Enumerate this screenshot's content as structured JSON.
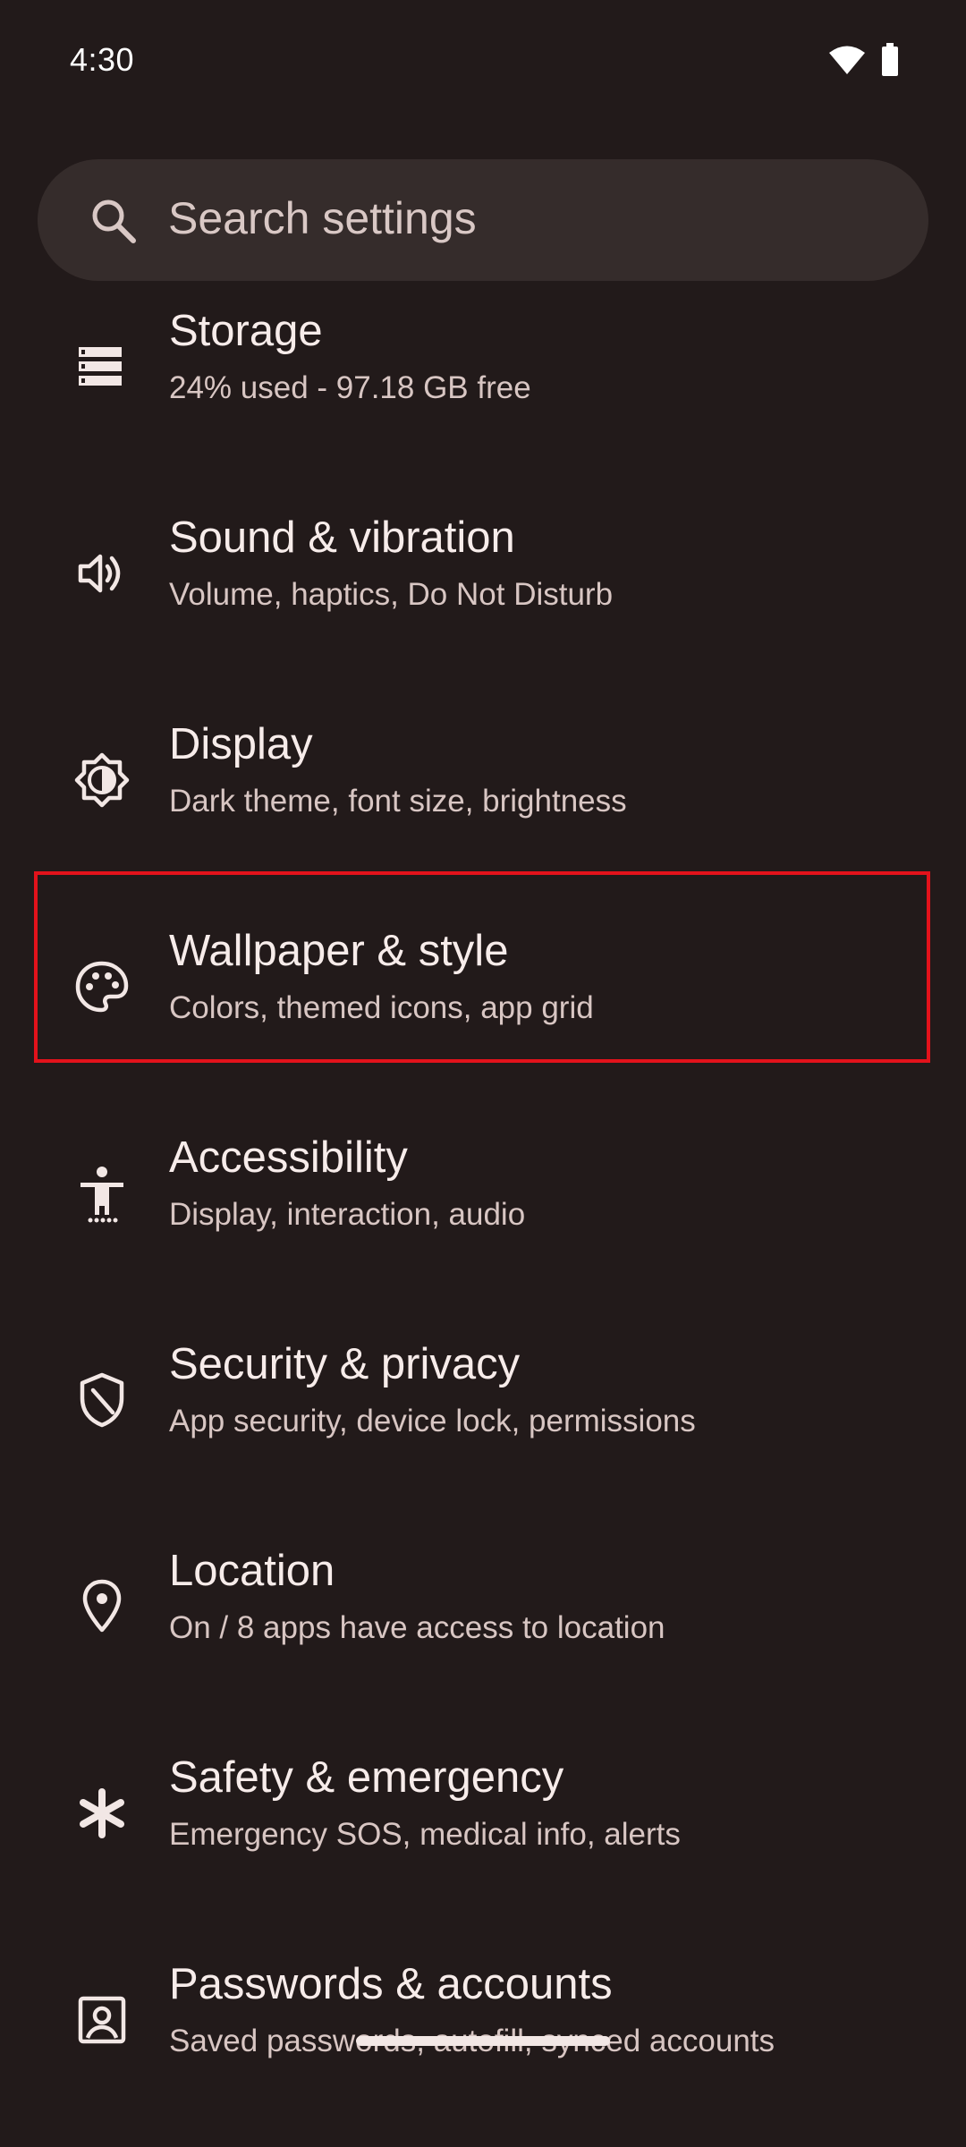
{
  "status_bar": {
    "time": "4:30",
    "wifi_icon": "wifi-icon",
    "battery_icon": "battery-icon"
  },
  "search": {
    "placeholder": "Search settings",
    "icon": "search-icon"
  },
  "settings": [
    {
      "title": "Storage",
      "summary": "24% used - 97.18 GB free",
      "icon": "storage-icon"
    },
    {
      "title": "Sound & vibration",
      "summary": "Volume, haptics, Do Not Disturb",
      "icon": "volume-icon"
    },
    {
      "title": "Display",
      "summary": "Dark theme, font size, brightness",
      "icon": "brightness-icon"
    },
    {
      "title": "Wallpaper & style",
      "summary": "Colors, themed icons, app grid",
      "icon": "palette-icon",
      "highlighted": true
    },
    {
      "title": "Accessibility",
      "summary": "Display, interaction, audio",
      "icon": "accessibility-icon"
    },
    {
      "title": "Security & privacy",
      "summary": "App security, device lock, permissions",
      "icon": "shield-icon"
    },
    {
      "title": "Location",
      "summary": "On / 8 apps have access to location",
      "icon": "location-pin-icon"
    },
    {
      "title": "Safety & emergency",
      "summary": "Emergency SOS, medical info, alerts",
      "icon": "asterisk-icon"
    },
    {
      "title": "Passwords & accounts",
      "summary": "Saved passwords, autofill, synced accounts",
      "icon": "account-box-icon"
    }
  ],
  "colors": {
    "background": "#221a1a",
    "search_background": "#352c2b",
    "highlight": "#e3121b",
    "primary_text": "#f7ecea",
    "secondary_text": "#d8c6c3"
  }
}
